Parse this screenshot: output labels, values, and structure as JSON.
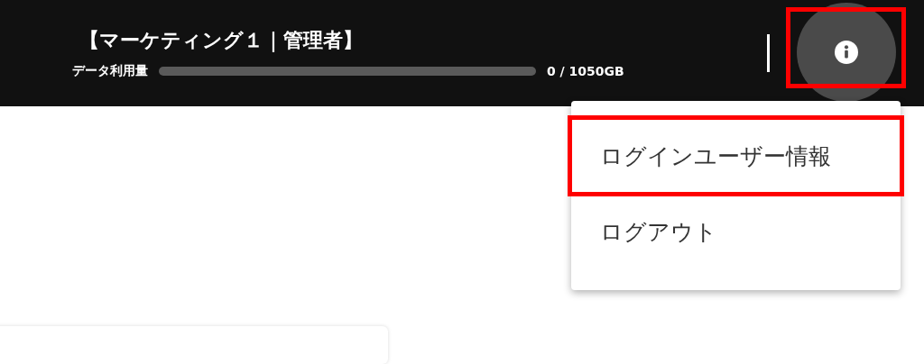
{
  "header": {
    "title": "【マーケティング１｜管理者】",
    "usage": {
      "label": "データ利用量",
      "level": 0,
      "reading": "0 / 1050GB"
    },
    "info_button": {
      "highlighted": true
    }
  },
  "menu": {
    "items": [
      {
        "label": "ログインユーザー情報",
        "highlighted": true
      },
      {
        "label": "ログアウト",
        "highlighted": false
      }
    ]
  }
}
